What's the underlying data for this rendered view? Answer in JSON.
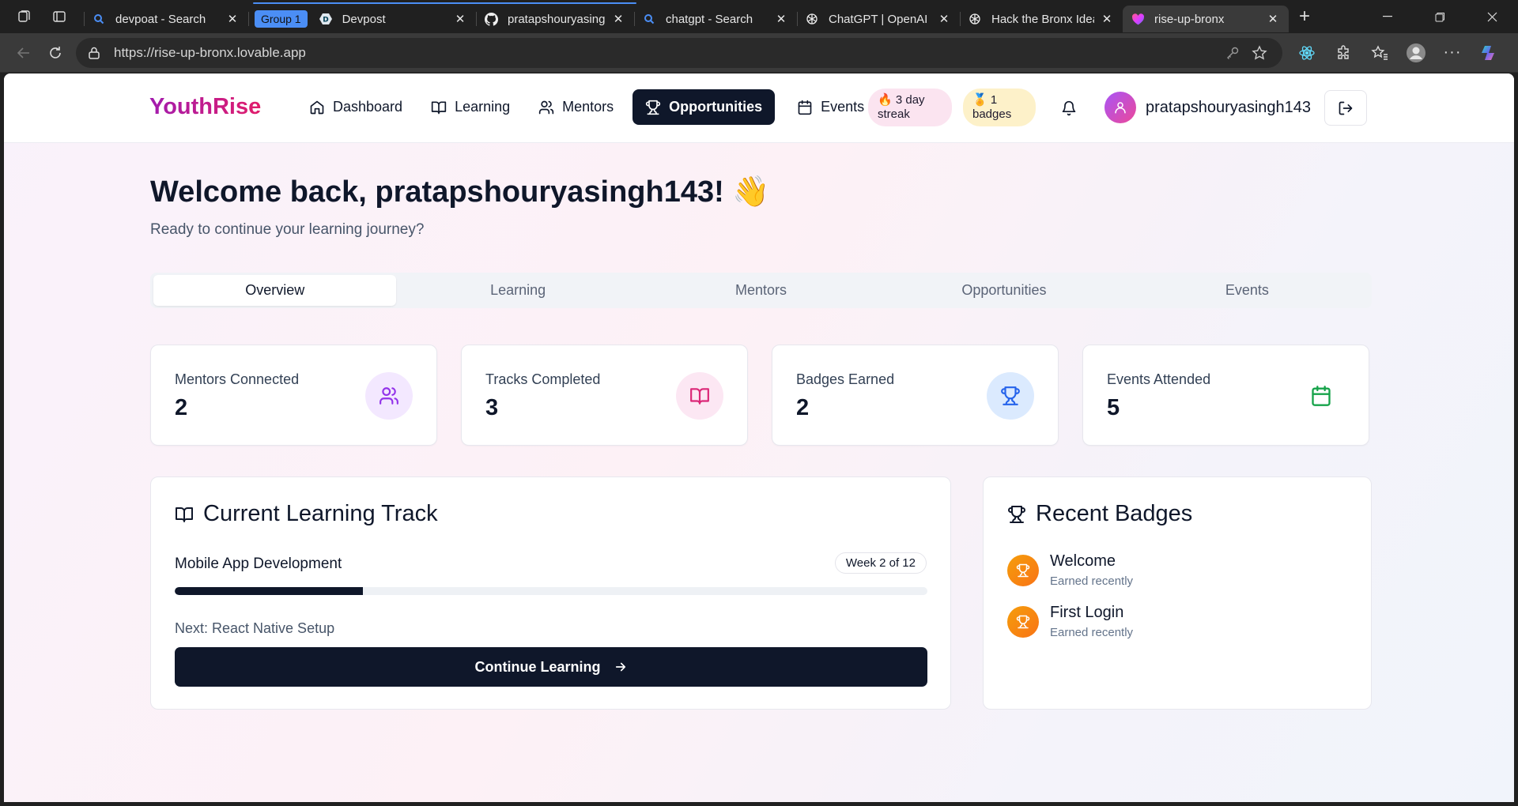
{
  "browser": {
    "tab_group_label": "Group 1",
    "tabs": [
      {
        "title": "devpoat - Search",
        "icon": "search-icon"
      },
      {
        "title": "Devpost",
        "icon": "devpost-icon"
      },
      {
        "title": "pratapshouryasingh",
        "icon": "github-icon"
      },
      {
        "title": "chatgpt - Search",
        "icon": "search-icon"
      },
      {
        "title": "ChatGPT | OpenAI",
        "icon": "openai-icon"
      },
      {
        "title": "Hack the Bronx Idea",
        "icon": "openai-icon"
      },
      {
        "title": "rise-up-bronx",
        "icon": "lovable-icon"
      }
    ],
    "url": "https://rise-up-bronx.lovable.app"
  },
  "app": {
    "brand": "YouthRise",
    "nav": {
      "dashboard": "Dashboard",
      "learning": "Learning",
      "mentors": "Mentors",
      "opportunities": "Opportunities",
      "events": "Events"
    },
    "streak_line1": "🔥 3 day",
    "streak_line2": "streak",
    "badges_line1": "🏅 1",
    "badges_line2": "badges",
    "username": "pratapshouryasingh143"
  },
  "dashboard": {
    "welcome": "Welcome back, pratapshouryasingh143! 👋",
    "subtitle": "Ready to continue your learning journey?",
    "tabs": [
      "Overview",
      "Learning",
      "Mentors",
      "Opportunities",
      "Events"
    ],
    "active_tab": "Overview",
    "stats": [
      {
        "label": "Mentors Connected",
        "value": "2",
        "icon": "users-icon",
        "color": "#9333ea"
      },
      {
        "label": "Tracks Completed",
        "value": "3",
        "icon": "book-open-icon",
        "color": "#db2777"
      },
      {
        "label": "Badges Earned",
        "value": "2",
        "icon": "trophy-icon",
        "color": "#2563eb"
      },
      {
        "label": "Events Attended",
        "value": "5",
        "icon": "calendar-icon",
        "color": "#16a34a"
      }
    ],
    "learning_track": {
      "heading": "Current Learning Track",
      "track": "Mobile App Development",
      "week": "Week 2 of 12",
      "progress_fraction": 0.25,
      "next": "Next: React Native Setup",
      "cta": "Continue Learning"
    },
    "recent_badges": {
      "heading": "Recent Badges",
      "items": [
        {
          "name": "Welcome",
          "earned": "Earned recently"
        },
        {
          "name": "First Login",
          "earned": "Earned recently"
        }
      ]
    }
  }
}
